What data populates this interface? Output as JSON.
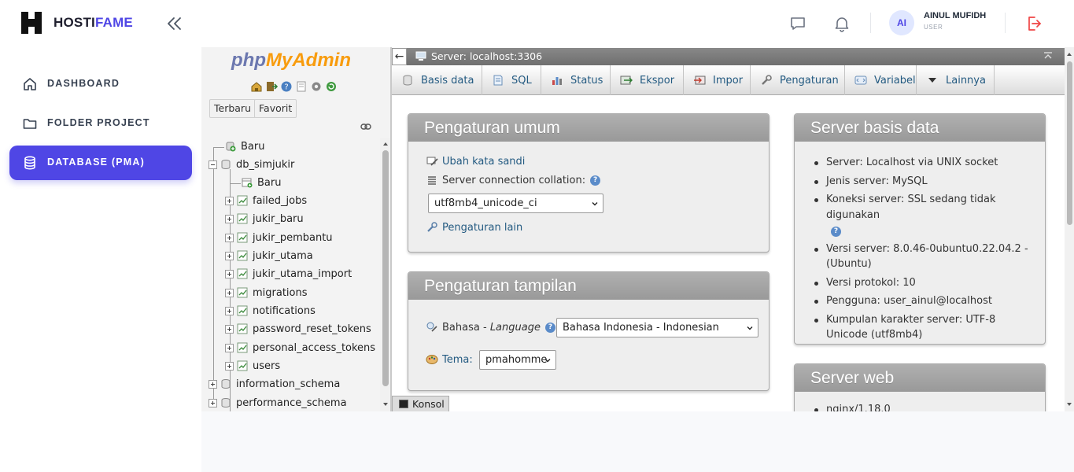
{
  "app": {
    "brand_main": "HOSTI",
    "brand_accent": "FAME",
    "accent_color": "#4f46e5"
  },
  "header": {
    "avatar_initials": "AI",
    "user_name": "AINUL MUFIDH",
    "user_role": "USER",
    "icons": [
      "collapse-icon",
      "chat-icon",
      "bell-icon",
      "logout-icon"
    ]
  },
  "sidebar": {
    "items": [
      {
        "label": "DASHBOARD",
        "icon": "home-icon",
        "active": false
      },
      {
        "label": "FOLDER PROJECT",
        "icon": "folder-icon",
        "active": false
      },
      {
        "label": "DATABASE (PMA)",
        "icon": "database-icon",
        "active": true
      }
    ]
  },
  "pma_nav": {
    "logo_php": "php",
    "logo_my": "My",
    "logo_admin": "Admin",
    "tab_recent": "Terbaru",
    "tab_favorite": "Favorit",
    "tree": {
      "new_root": "Baru",
      "db_current": "db_simjukir",
      "new_table": "Baru",
      "tables": [
        "failed_jobs",
        "jukir_baru",
        "jukir_pembantu",
        "jukir_utama",
        "jukir_utama_import",
        "migrations",
        "notifications",
        "password_reset_tokens",
        "personal_access_tokens",
        "users"
      ],
      "other_dbs": [
        "information_schema",
        "performance_schema"
      ]
    }
  },
  "pma_main": {
    "server_title": "Server: localhost:3306",
    "back_label": "←",
    "tabs": [
      "Basis data",
      "SQL",
      "Status",
      "Ekspor",
      "Impor",
      "Pengaturan",
      "Variabel",
      "Lainnya"
    ],
    "general": {
      "title": "Pengaturan umum",
      "change_password": "Ubah kata sandi",
      "collation_label": "Server connection collation:",
      "collation_value": "utf8mb4_unicode_ci",
      "more_settings": "Pengaturan lain"
    },
    "appearance": {
      "title": "Pengaturan tampilan",
      "language_label": "Bahasa",
      "language_sep": " - ",
      "language_label_en": "Language",
      "language_value": "Bahasa Indonesia - Indonesian",
      "theme_label": "Tema:",
      "theme_value": "pmahomme"
    },
    "db_server": {
      "title": "Server basis data",
      "items": [
        "Server: Localhost via UNIX socket",
        "Jenis server: MySQL",
        "Koneksi server: SSL sedang tidak digunakan",
        "Versi server: 8.0.46-0ubuntu0.22.04.2 - (Ubuntu)",
        "Versi protokol: 10",
        "Pengguna: user_ainul@localhost",
        "Kumpulan karakter server: UTF-8 Unicode (utf8mb4)"
      ]
    },
    "web_server": {
      "title": "Server web",
      "first_item": "nginx/1.18.0"
    },
    "console_label": "Konsol"
  }
}
